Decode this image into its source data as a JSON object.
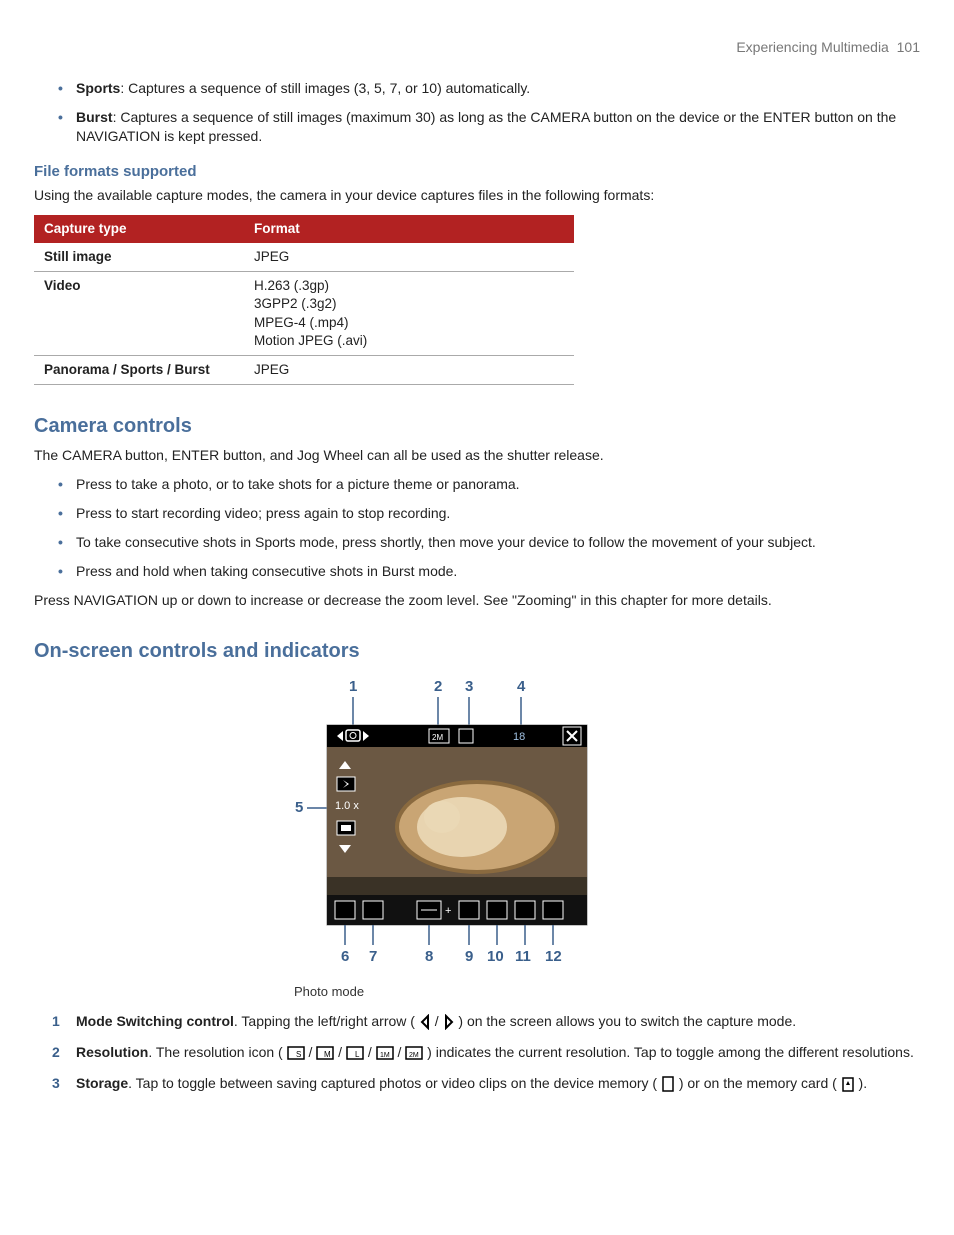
{
  "header": {
    "section": "Experiencing Multimedia",
    "page": "101"
  },
  "top_bullets": [
    {
      "label": "Sports",
      "desc": ": Captures a sequence of still images (3, 5, 7, or 10) automatically."
    },
    {
      "label": "Burst",
      "desc": ": Captures a sequence of still images (maximum 30) as long as the CAMERA button on the device or the ENTER button on the NAVIGATION is kept pressed."
    }
  ],
  "file_formats": {
    "heading": "File formats supported",
    "intro": "Using the available capture modes, the camera in your device captures files in the following formats:",
    "columns": [
      "Capture type",
      "Format"
    ],
    "rows": [
      {
        "type": "Still image",
        "format": "JPEG"
      },
      {
        "type": "Video",
        "format": "H.263 (.3gp)\n3GPP2 (.3g2)\nMPEG-4 (.mp4)\nMotion JPEG (.avi)"
      },
      {
        "type": "Panorama / Sports / Burst",
        "format": "JPEG"
      }
    ]
  },
  "camera_controls": {
    "heading": "Camera controls",
    "intro": "The CAMERA button, ENTER button, and Jog Wheel can all be used as the shutter release.",
    "bullets": [
      "Press to take a photo, or to take shots for a picture theme or panorama.",
      "Press to start recording video; press again to stop recording.",
      "To take consecutive shots in Sports mode, press shortly, then move your device to follow the movement of your subject.",
      "Press and hold when taking consecutive shots in Burst mode."
    ],
    "outro": "Press NAVIGATION up or down to increase or decrease the zoom level. See \"Zooming\" in this chapter for more details."
  },
  "onscreen": {
    "heading": "On-screen controls and indicators",
    "callout_numbers": [
      "1",
      "2",
      "3",
      "4",
      "5",
      "6",
      "7",
      "8",
      "9",
      "10",
      "11",
      "12"
    ],
    "caption": "Photo mode",
    "overlay": {
      "resolution_label": "2M",
      "remaining": "18",
      "zoom": "1.0 x"
    },
    "items": [
      {
        "num": "1",
        "label": "Mode Switching control",
        "desc_pre": ". Tapping the left/right arrow ( ",
        "desc_mid": " / ",
        "desc_post": " ) on the screen allows you to switch the capture mode."
      },
      {
        "num": "2",
        "label": "Resolution",
        "desc_pre": ". The resolution icon ( ",
        "desc_post": " ) indicates the current resolution. Tap to toggle among the different resolutions."
      },
      {
        "num": "3",
        "label": "Storage",
        "desc_pre": ". Tap to toggle between saving captured photos or video clips on the device memory ( ",
        "desc_mid": " ) or on the memory card ( ",
        "desc_post": " )."
      }
    ]
  }
}
